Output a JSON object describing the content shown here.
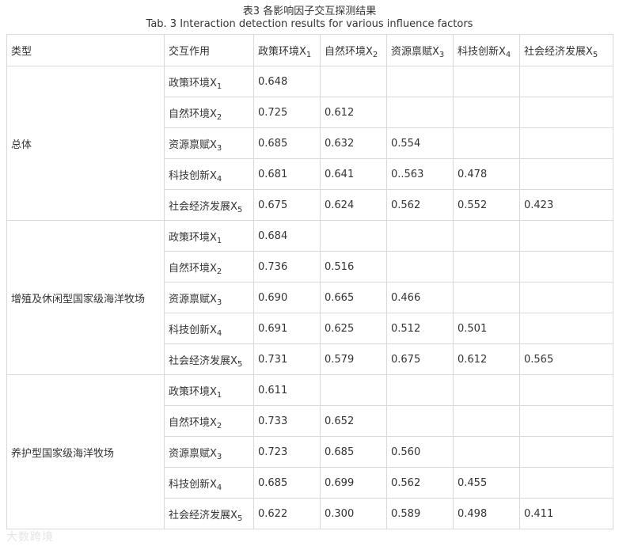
{
  "title_zh": "表3 各影响因子交互探测结果",
  "title_en": "Tab. 3 Interaction detection results for various influence factors",
  "header": {
    "type": "类型",
    "interaction": "交互作用",
    "columns": [
      {
        "name": "政策环境X",
        "sub": "1"
      },
      {
        "name": "自然环境X",
        "sub": "2"
      },
      {
        "name": "资源禀赋X",
        "sub": "3"
      },
      {
        "name": "科技创新X",
        "sub": "4"
      },
      {
        "name": "社会经济发展X",
        "sub": "5"
      }
    ]
  },
  "groups": [
    {
      "type": "总体",
      "rows": [
        {
          "factor": "政策环境X",
          "sub": "1",
          "values": [
            "0.648",
            "",
            "",
            "",
            ""
          ]
        },
        {
          "factor": "自然环境X",
          "sub": "2",
          "values": [
            "0.725",
            "0.612",
            "",
            "",
            ""
          ]
        },
        {
          "factor": "资源禀赋X",
          "sub": "3",
          "values": [
            "0.685",
            "0.632",
            "0.554",
            "",
            ""
          ]
        },
        {
          "factor": "科技创新X",
          "sub": "4",
          "values": [
            "0.681",
            "0.641",
            "0..563",
            "0.478",
            ""
          ]
        },
        {
          "factor": "社会经济发展X",
          "sub": "5",
          "values": [
            "0.675",
            "0.624",
            "0.562",
            "0.552",
            "0.423"
          ]
        }
      ]
    },
    {
      "type": "增殖及休闲型国家级海洋牧场",
      "rows": [
        {
          "factor": "政策环境X",
          "sub": "1",
          "values": [
            "0.684",
            "",
            "",
            "",
            ""
          ]
        },
        {
          "factor": "自然环境X",
          "sub": "2",
          "values": [
            "0.736",
            "0.516",
            "",
            "",
            ""
          ]
        },
        {
          "factor": "资源禀赋X",
          "sub": "3",
          "values": [
            "0.690",
            "0.665",
            "0.466",
            "",
            ""
          ]
        },
        {
          "factor": "科技创新X",
          "sub": "4",
          "values": [
            "0.691",
            "0.625",
            "0.512",
            "0.501",
            ""
          ]
        },
        {
          "factor": "社会经济发展X",
          "sub": "5",
          "values": [
            "0.731",
            "0.579",
            "0.675",
            "0.612",
            "0.565"
          ]
        }
      ]
    },
    {
      "type": "养护型国家级海洋牧场",
      "rows": [
        {
          "factor": "政策环境X",
          "sub": "1",
          "values": [
            "0.611",
            "",
            "",
            "",
            ""
          ]
        },
        {
          "factor": "自然环境X",
          "sub": "2",
          "values": [
            "0.733",
            "0.652",
            "",
            "",
            ""
          ]
        },
        {
          "factor": "资源禀赋X",
          "sub": "3",
          "values": [
            "0.723",
            "0.685",
            "0.560",
            "",
            ""
          ]
        },
        {
          "factor": "科技创新X",
          "sub": "4",
          "values": [
            "0.685",
            "0.699",
            "0.562",
            "0.455",
            ""
          ]
        },
        {
          "factor": "社会经济发展X",
          "sub": "5",
          "values": [
            "0.622",
            "0.300",
            "0.589",
            "0.498",
            "0.411"
          ]
        }
      ]
    }
  ],
  "watermark": "大数跨境"
}
